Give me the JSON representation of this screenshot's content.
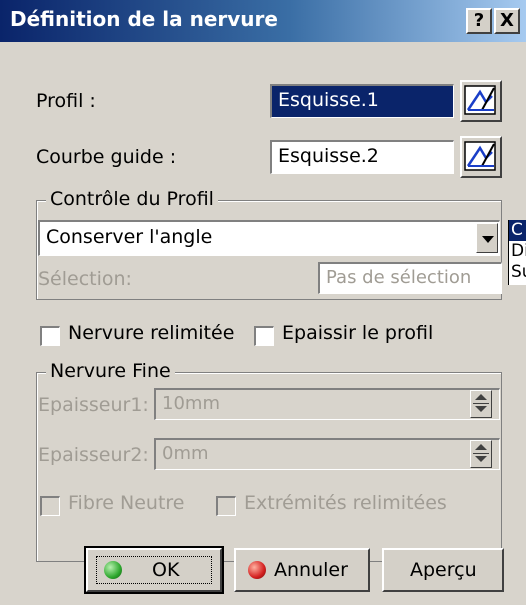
{
  "window": {
    "title": "Définition de la nervure",
    "help_button": "?",
    "close_button": "X"
  },
  "profile": {
    "label": "Profil :",
    "value": "Esquisse.1",
    "icon": "sketcher-icon"
  },
  "guide": {
    "label": "Courbe guide :",
    "value": "Esquisse.2",
    "icon": "sketcher-icon"
  },
  "profile_control": {
    "legend": "Contrôle du Profil",
    "selected_option": "Conserver l'angle",
    "dropdown_options": [
      "C",
      "Di",
      "Su"
    ],
    "selection_label": "Sélection:",
    "selection_value": "Pas de sélection"
  },
  "options": {
    "relimited_label": "Nervure relimitée",
    "relimited_checked": false,
    "thicken_label": "Epaissir le profil",
    "thicken_checked": false
  },
  "thin_rib": {
    "legend": "Nervure Fine",
    "thickness1_label": "Epaisseur1:",
    "thickness1_value": "10mm",
    "thickness2_label": "Epaisseur2:",
    "thickness2_value": "0mm",
    "neutral_fiber_label": "Fibre Neutre",
    "neutral_fiber_checked": false,
    "merge_ends_label": "Extrémités relimitées",
    "merge_ends_checked": false
  },
  "buttons": {
    "ok": "OK",
    "cancel": "Annuler",
    "preview": "Aperçu"
  },
  "colors": {
    "title_bar": "#0a246a",
    "selection": "#0a246a",
    "ok_dot": "#2ea82e",
    "cancel_dot": "#d42020"
  }
}
